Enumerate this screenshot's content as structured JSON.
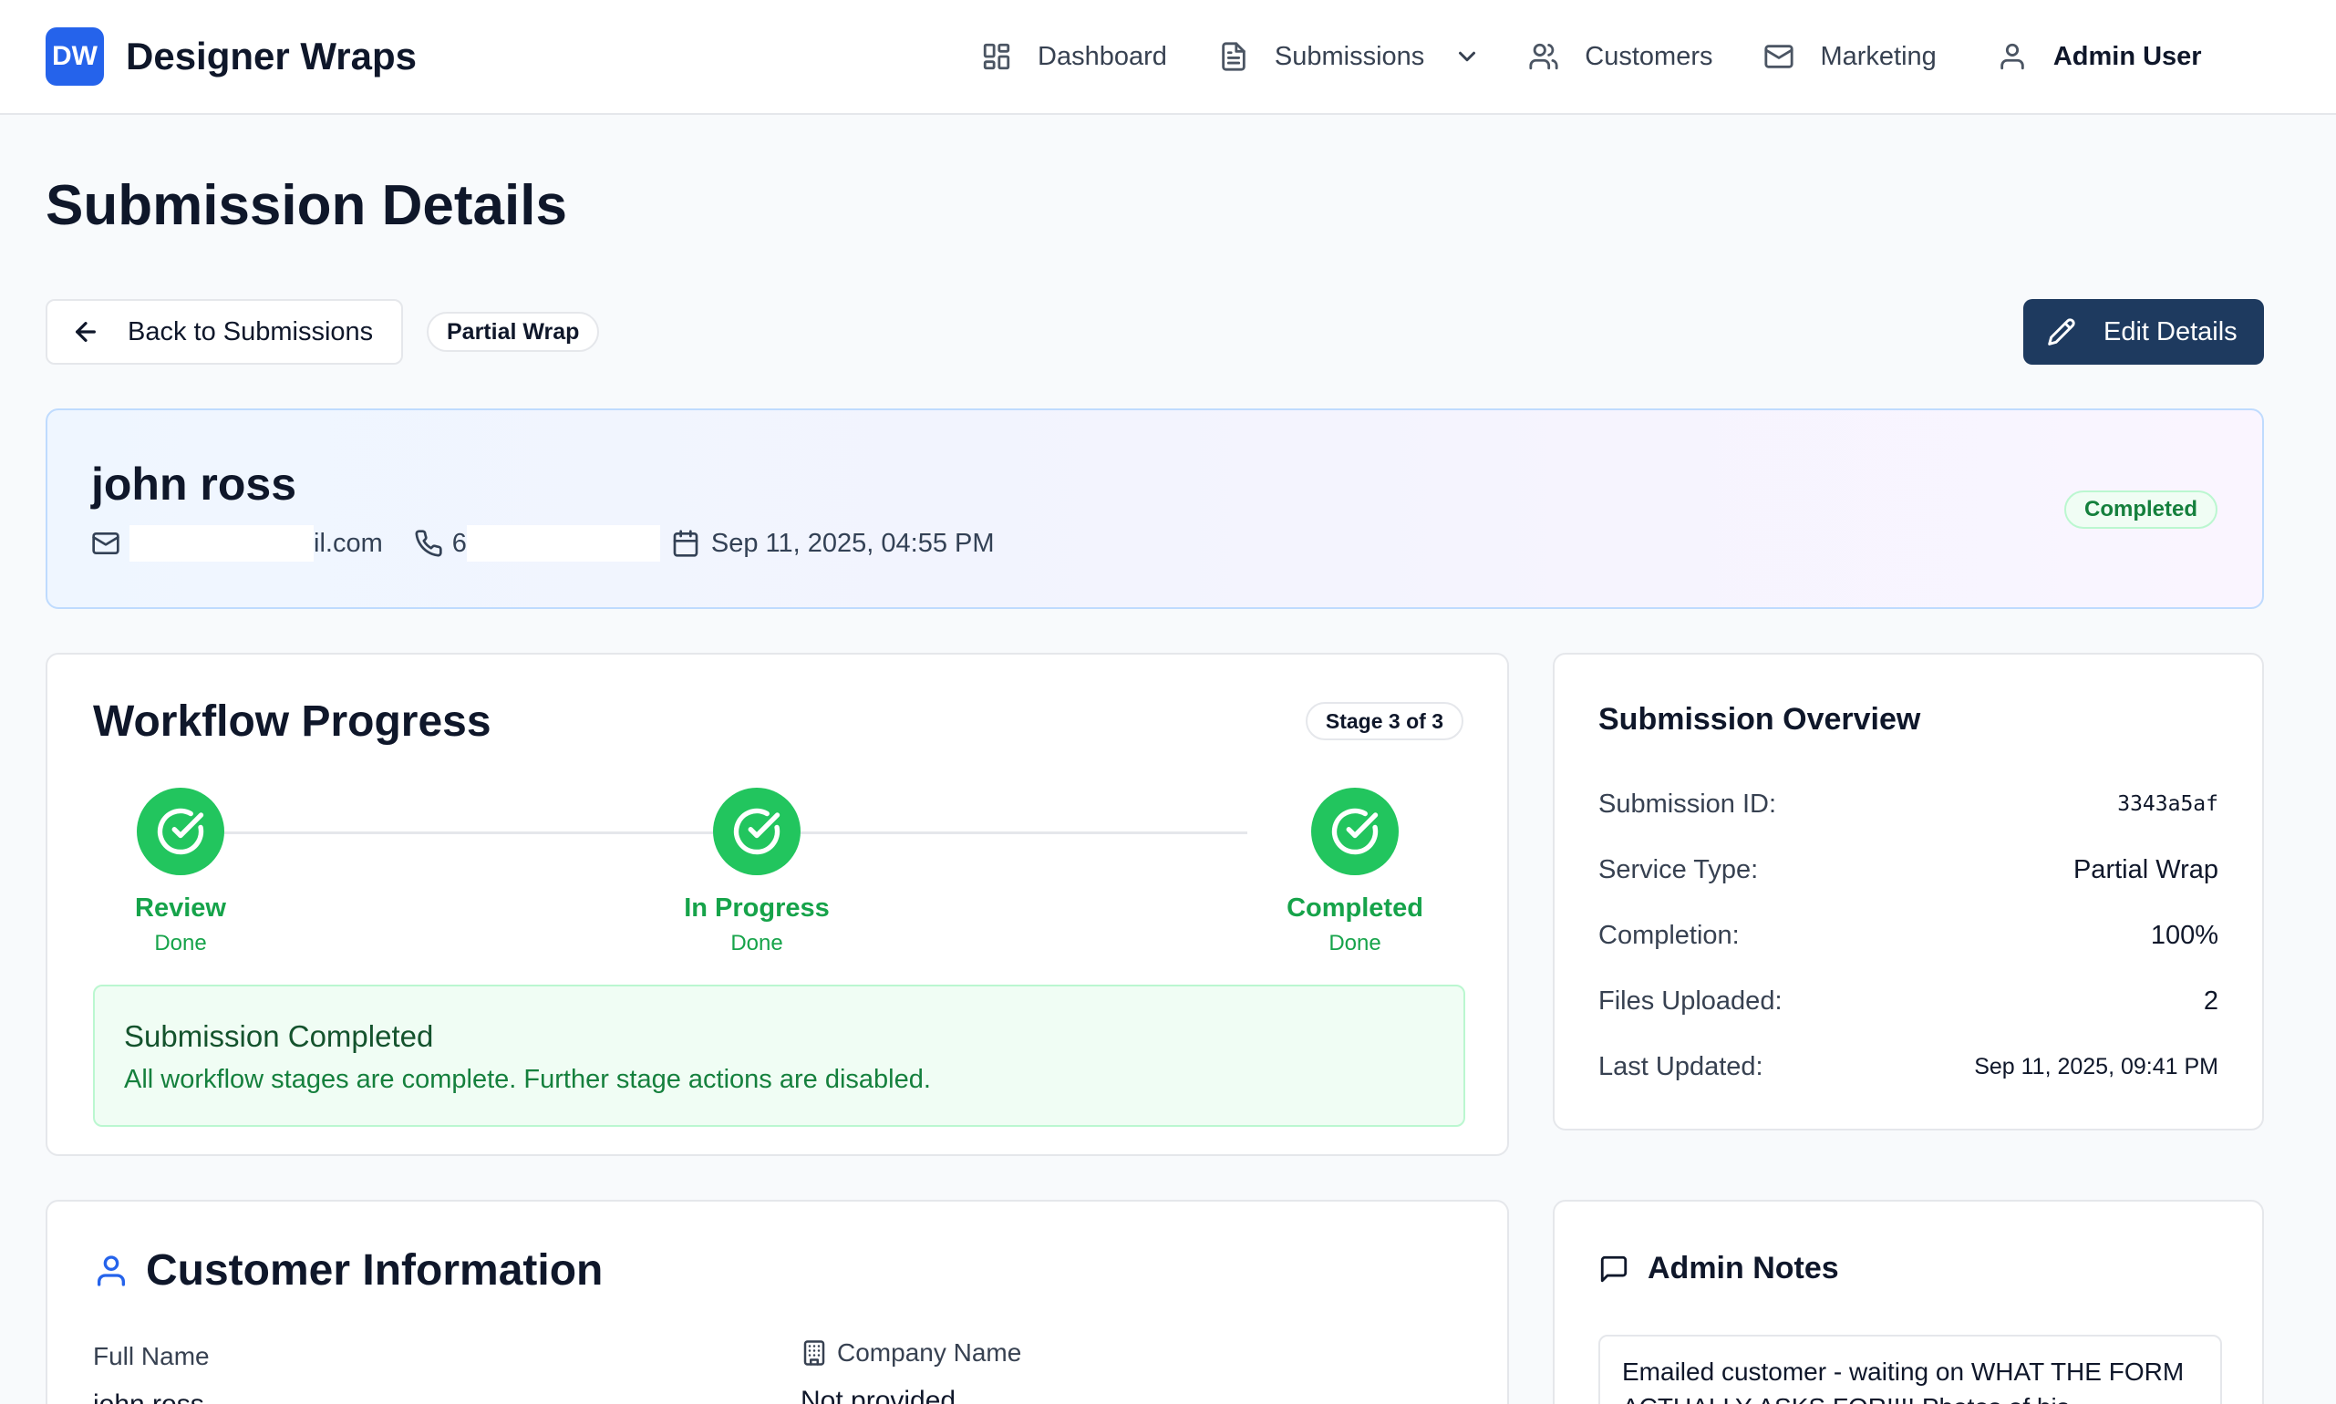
{
  "header": {
    "logo_text": "DW",
    "brand_name": "Designer Wraps",
    "nav": {
      "dashboard": "Dashboard",
      "submissions": "Submissions",
      "customers": "Customers",
      "marketing": "Marketing",
      "user": "Admin User"
    }
  },
  "page": {
    "title": "Submission Details",
    "back_label": "Back to Submissions",
    "service_pill": "Partial Wrap",
    "edit_label": "Edit Details"
  },
  "customer_banner": {
    "name": "john ross",
    "email_visible": "il.com",
    "phone_visible": "6",
    "submitted_at": "Sep 11, 2025, 04:55 PM",
    "status": "Completed"
  },
  "workflow": {
    "title": "Workflow Progress",
    "stage_badge": "Stage 3 of 3",
    "progress_fraction": 1.0,
    "steps": [
      {
        "label": "Review",
        "status": "Done"
      },
      {
        "label": "In Progress",
        "status": "Done"
      },
      {
        "label": "Completed",
        "status": "Done"
      }
    ],
    "completed_title": "Submission Completed",
    "completed_text": "All workflow stages are complete. Further stage actions are disabled."
  },
  "overview": {
    "title": "Submission Overview",
    "rows": [
      {
        "label": "Submission ID:",
        "value": "3343a5af"
      },
      {
        "label": "Service Type:",
        "value": "Partial Wrap"
      },
      {
        "label": "Completion:",
        "value": "100%"
      },
      {
        "label": "Files Uploaded:",
        "value": "2"
      },
      {
        "label": "Last Updated:",
        "value": "Sep 11, 2025, 09:41 PM"
      }
    ]
  },
  "customer_info": {
    "title": "Customer Information",
    "full_name_label": "Full Name",
    "full_name_value": "john ross",
    "company_label": "Company Name",
    "company_value": "Not provided"
  },
  "admin_notes": {
    "title": "Admin Notes",
    "note": "Emailed customer - waiting on WHAT THE FORM ACTUALLY ASKS FOR!!!! Photos of his"
  },
  "colors": {
    "brand_blue": "#2563eb",
    "edit_button": "#1e3a5f",
    "success_green": "#22c55e"
  }
}
